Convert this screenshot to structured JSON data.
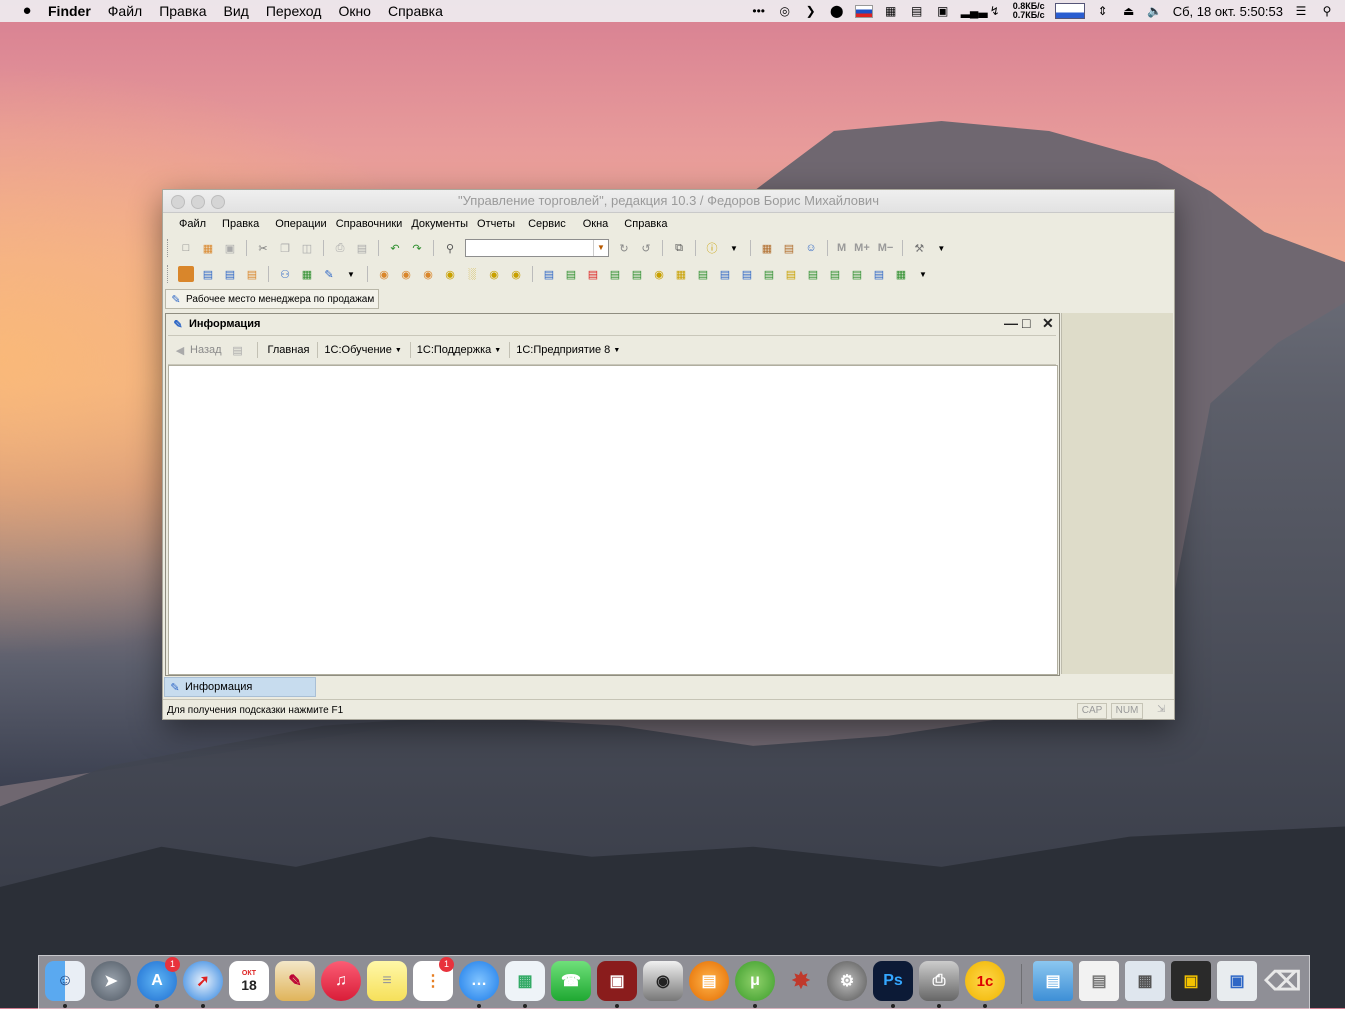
{
  "menubar": {
    "app": "Finder",
    "items": [
      "Файл",
      "Правка",
      "Вид",
      "Переход",
      "Окно",
      "Справка"
    ],
    "net_up": "0.8КБ/с",
    "net_down": "0.7КБ/с",
    "clock": "Сб, 18 окт.  5:50:53"
  },
  "window": {
    "title": "\"Управление торговлей\", редакция 10.3 / Федоров Борис Михайлович",
    "menu": [
      "Файл",
      "Правка",
      "Операции",
      "Справочники",
      "Документы",
      "Отчеты",
      "Сервис",
      "Окна",
      "Справка"
    ],
    "toolbar_m": [
      "M",
      "M+",
      "M−"
    ],
    "workspace_button": "Рабочее место менеджера по продажам",
    "inner": {
      "title": "Информация",
      "nav": {
        "back": "Назад",
        "home": "Главная",
        "links": [
          "1С:Обучение",
          "1С:Поддержка",
          "1С:Предприятие 8"
        ]
      }
    },
    "task": "Информация",
    "status": "Для получения подсказки нажмите F1",
    "cap": "CAP",
    "num": "NUM"
  },
  "dock": {
    "calendar_month": "ОКТ",
    "calendar_day": "18",
    "badges": {
      "appstore": "1",
      "reminders": "1"
    }
  },
  "colors": {
    "window_bg": "#ecebe0",
    "task_active": "#c7dcee",
    "toolbar_icon_orange": "#d9862b",
    "toolbar_icon_green": "#2c8e2c",
    "toolbar_icon_blue": "#2e67c6"
  }
}
